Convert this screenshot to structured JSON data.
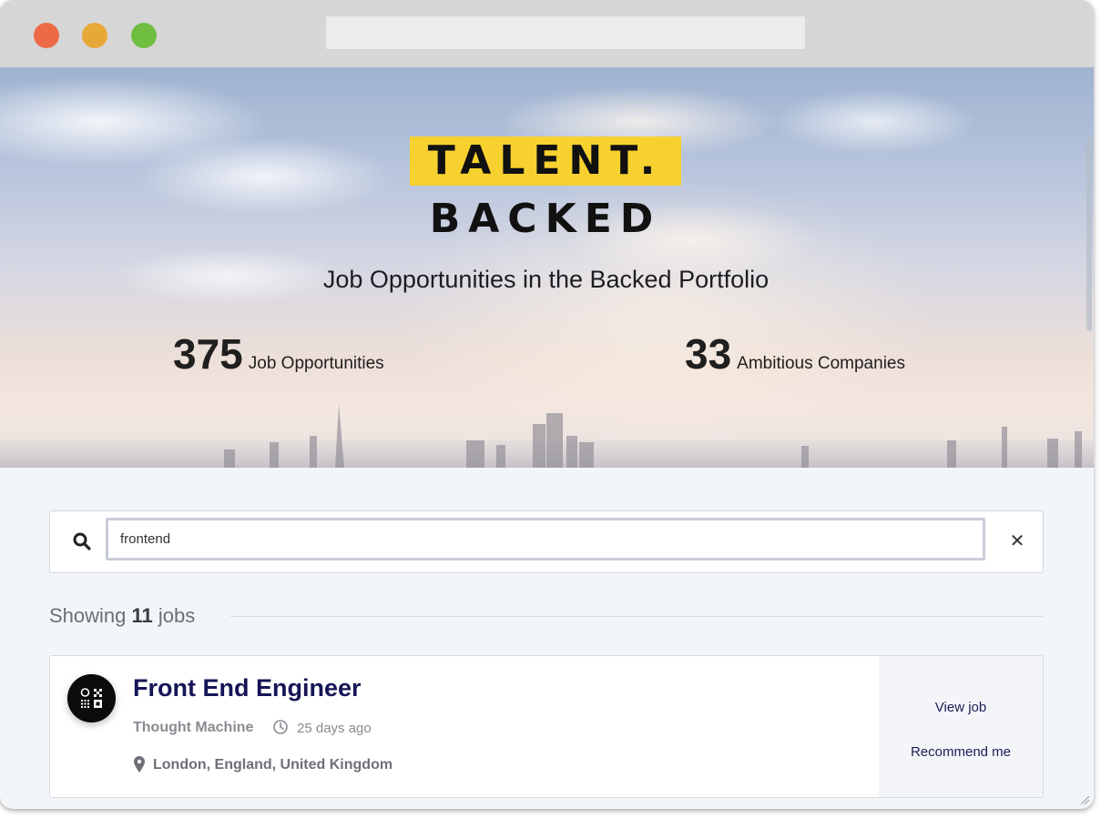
{
  "browser": {
    "url": ""
  },
  "hero": {
    "logo_line1": "TALENT.",
    "logo_line2": "BACKED",
    "subtitle": "Job Opportunities in the Backed Portfolio",
    "stats": [
      {
        "value": "375",
        "label": "Job Opportunities"
      },
      {
        "value": "33",
        "label": "Ambitious Companies"
      }
    ]
  },
  "search": {
    "value": "frontend",
    "icon": "search-icon",
    "clear_icon": "close-icon",
    "clear_glyph": "✕"
  },
  "results": {
    "prefix": "Showing",
    "count": "11",
    "suffix": "jobs"
  },
  "jobs": [
    {
      "title": "Front End Engineer",
      "company": "Thought Machine",
      "posted": "25 days ago",
      "location": "London, England, United Kingdom",
      "actions": {
        "view": "View job",
        "recommend": "Recommend me"
      }
    }
  ],
  "colors": {
    "logo_yellow": "#f7d12f",
    "title_navy": "#151557",
    "traffic_red": "#ed6a47",
    "traffic_yellow": "#e8a838",
    "traffic_green": "#6fbe3f"
  }
}
